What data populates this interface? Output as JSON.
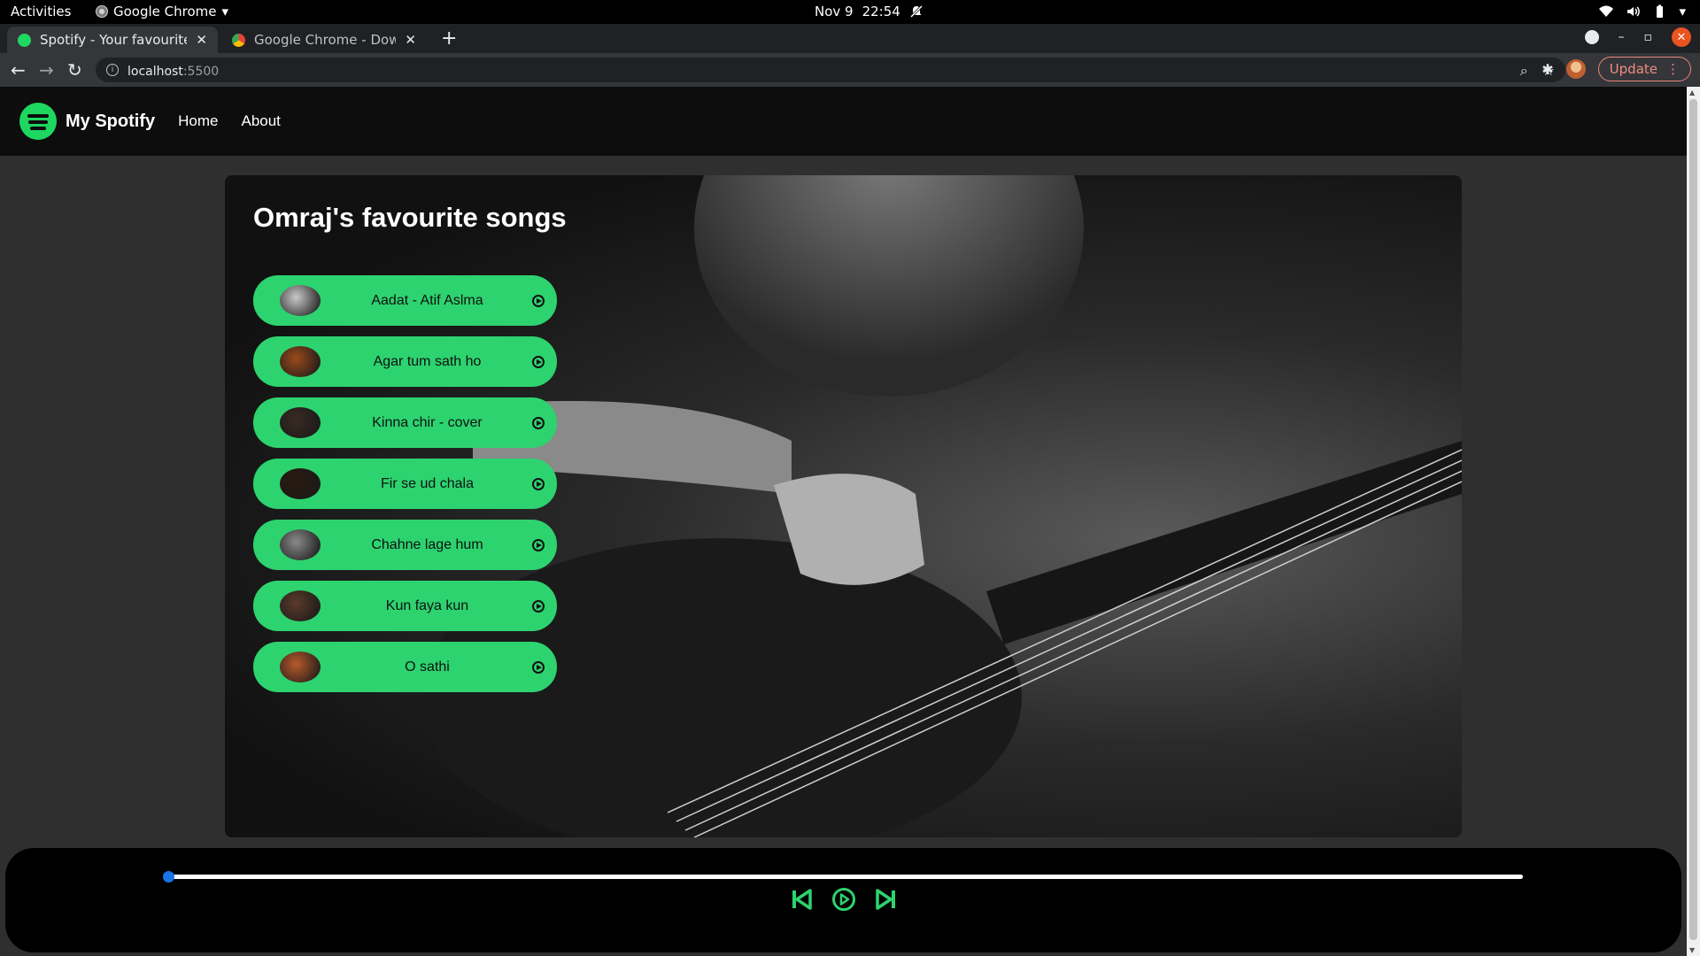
{
  "system": {
    "activities": "Activities",
    "app_name": "Google Chrome",
    "date": "Nov 9",
    "time": "22:54"
  },
  "tabs": [
    {
      "title": "Spotify - Your favourite m",
      "favicon": "spotify-favicon",
      "active": true
    },
    {
      "title": "Google Chrome - Downlo",
      "favicon": "chrome-favicon",
      "active": false
    }
  ],
  "toolbar": {
    "url_host": "localhost",
    "url_port": ":5500",
    "update_label": "Update"
  },
  "navbar": {
    "brand": "My Spotify",
    "links": [
      "Home",
      "About"
    ]
  },
  "hero": {
    "title": "Omraj's favourite songs"
  },
  "songs": [
    {
      "name": "Aadat - Atif Aslma",
      "thumb_color": "#c9c9c9"
    },
    {
      "name": "Agar tum sath ho",
      "thumb_color": "#9a4a1a"
    },
    {
      "name": "Kinna chir - cover",
      "thumb_color": "#3a2a22"
    },
    {
      "name": "Fir se ud chala",
      "thumb_color": "#2a1a10"
    },
    {
      "name": "Chahne lage hum",
      "thumb_color": "#8a8a8a"
    },
    {
      "name": "Kun faya kun",
      "thumb_color": "#5a3a2a"
    },
    {
      "name": "O sathi",
      "thumb_color": "#b85a2a"
    }
  ],
  "player": {
    "progress": 0,
    "accent": "#2dd36f"
  }
}
